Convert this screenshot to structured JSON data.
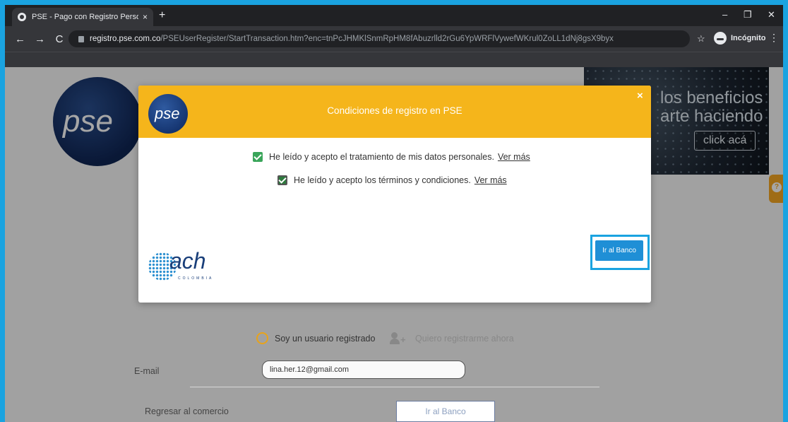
{
  "browser": {
    "tab_title": "PSE - Pago con Registro Persona",
    "tab_close": "×",
    "new_tab": "+",
    "url_host": "registro.pse.com.co",
    "url_path": "/PSEUserRegister/StartTransaction.htm?enc=tnPcJHMKlSnmRpHM8fAbuzrlld2rGu6YpWRFlVywefWKrul0ZoLL1dNj8gsX9byx",
    "incognito_label": "Incógnito",
    "back": "←",
    "forward": "→",
    "reload": "C",
    "star": "☆",
    "menu": "⋮",
    "minimize": "–",
    "maximize": "❐",
    "close": "✕"
  },
  "background": {
    "logo_text": "pse",
    "banner_line1": "los beneficios",
    "banner_line2": "arte haciendo",
    "banner_cta": "click acá",
    "help": "?",
    "option_registered": "Soy un usuario registrado",
    "option_register": "Quiero registrarme ahora",
    "email_label": "E-mail",
    "email_value": "lina.her.12@gmail.com",
    "back_link": "Regresar al comercio",
    "bank_button": "Ir al Banco"
  },
  "modal": {
    "logo_text": "pse",
    "title": "Condiciones de registro en PSE",
    "close": "×",
    "condition1": "He leído y acepto el tratamiento de mis datos personales.",
    "condition1_more": "Ver más",
    "condition2": "He leído y acepto los términos y condiciones.",
    "condition2_more": "Ver más",
    "ach_word": "ach",
    "ach_sub": "COLOMBIA",
    "bank_button": "Ir al Banco"
  },
  "colors": {
    "frame": "#1aa3e0",
    "modal_header": "#f5b51b",
    "checkbox": "#3aa55a",
    "primary_button": "#1f8fd6"
  }
}
